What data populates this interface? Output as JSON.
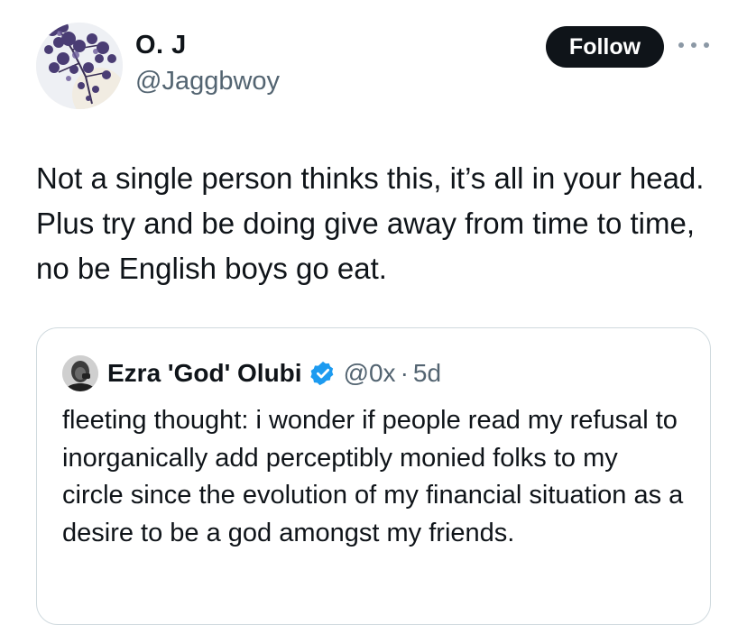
{
  "tweet": {
    "author_name": "O. J",
    "author_handle": "@Jaggbwoy",
    "follow_label": "Follow",
    "more_icon": "more-horizontal-icon",
    "text": "Not a single person thinks this, it’s all in your head. Plus try and be doing give away from time to time, no be English boys go eat."
  },
  "quote": {
    "author_name": "Ezra 'God' Olubi",
    "verified_icon": "verified-badge-icon",
    "author_handle": "@0x",
    "separator": "·",
    "time": "5d",
    "text": "fleeting thought: i wonder if people read my refusal to inorganically add perceptibly monied folks to my circle since the evolution of my financial situation as a desire to be a god amongst my friends."
  },
  "colors": {
    "text_primary": "#0f1419",
    "text_secondary": "#536471",
    "follow_bg": "#0f1419",
    "follow_text": "#ffffff",
    "verified": "#1d9bf0",
    "card_border": "#cfd9de"
  }
}
